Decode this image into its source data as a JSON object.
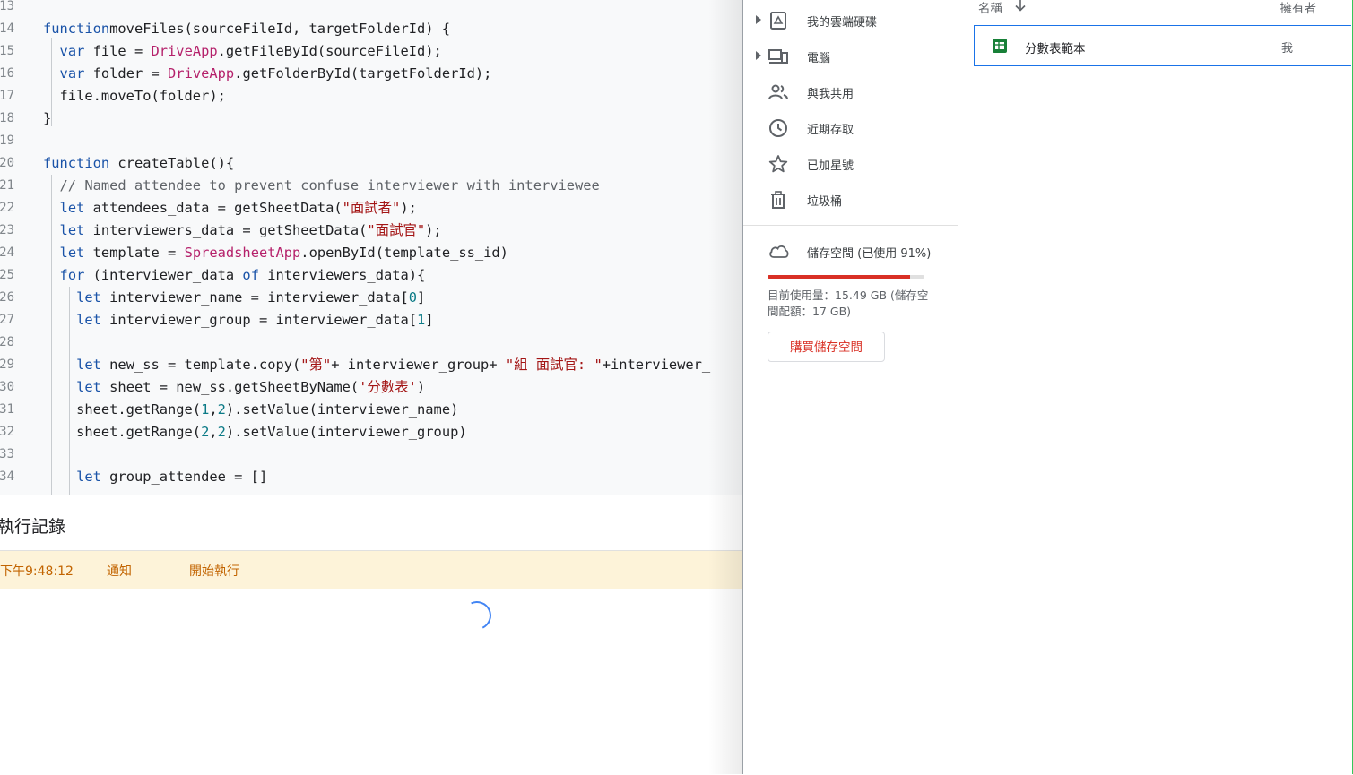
{
  "editor": {
    "lines": [
      {
        "n": "13",
        "tokens": []
      },
      {
        "n": "14",
        "tokens": [
          [
            "kw",
            "function"
          ],
          [
            "",
            "moveFiles(sourceFileId, targetFolderId) {"
          ]
        ]
      },
      {
        "n": "15",
        "tokens": [
          [
            "",
            "  "
          ],
          [
            "kw",
            "var"
          ],
          [
            "",
            " file = "
          ],
          [
            "cls",
            "DriveApp"
          ],
          [
            "",
            ".getFileById(sourceFileId);"
          ]
        ]
      },
      {
        "n": "16",
        "tokens": [
          [
            "",
            "  "
          ],
          [
            "kw",
            "var"
          ],
          [
            "",
            " folder = "
          ],
          [
            "cls",
            "DriveApp"
          ],
          [
            "",
            ".getFolderById(targetFolderId);"
          ]
        ]
      },
      {
        "n": "17",
        "tokens": [
          [
            "",
            "  file.moveTo(folder);"
          ]
        ]
      },
      {
        "n": "18",
        "tokens": [
          [
            "",
            "}"
          ]
        ]
      },
      {
        "n": "19",
        "tokens": []
      },
      {
        "n": "20",
        "tokens": [
          [
            "kw",
            "function"
          ],
          [
            "",
            " createTable(){"
          ]
        ]
      },
      {
        "n": "21",
        "tokens": [
          [
            "cmt",
            "  // Named attendee to prevent confuse interviewer with interviewee"
          ]
        ]
      },
      {
        "n": "22",
        "tokens": [
          [
            "",
            "  "
          ],
          [
            "kw",
            "let"
          ],
          [
            "",
            " attendees_data = getSheetData("
          ],
          [
            "str",
            "\"面試者\""
          ],
          [
            "",
            ");"
          ]
        ]
      },
      {
        "n": "23",
        "tokens": [
          [
            "",
            "  "
          ],
          [
            "kw",
            "let"
          ],
          [
            "",
            " interviewers_data = getSheetData("
          ],
          [
            "str",
            "\"面試官\""
          ],
          [
            "",
            ");"
          ]
        ]
      },
      {
        "n": "24",
        "tokens": [
          [
            "",
            "  "
          ],
          [
            "kw",
            "let"
          ],
          [
            "",
            " template = "
          ],
          [
            "cls",
            "SpreadsheetApp"
          ],
          [
            "",
            ".openById(template_ss_id)"
          ]
        ]
      },
      {
        "n": "25",
        "tokens": [
          [
            "",
            "  "
          ],
          [
            "kw",
            "for"
          ],
          [
            "",
            " (interviewer_data "
          ],
          [
            "kw",
            "of"
          ],
          [
            "",
            " interviewers_data){"
          ]
        ]
      },
      {
        "n": "26",
        "tokens": [
          [
            "",
            "    "
          ],
          [
            "kw",
            "let"
          ],
          [
            "",
            " interviewer_name = interviewer_data["
          ],
          [
            "num",
            "0"
          ],
          [
            "",
            "]"
          ]
        ]
      },
      {
        "n": "27",
        "tokens": [
          [
            "",
            "    "
          ],
          [
            "kw",
            "let"
          ],
          [
            "",
            " interviewer_group = interviewer_data["
          ],
          [
            "num",
            "1"
          ],
          [
            "",
            "]"
          ]
        ]
      },
      {
        "n": "28",
        "tokens": []
      },
      {
        "n": "29",
        "tokens": [
          [
            "",
            "    "
          ],
          [
            "kw",
            "let"
          ],
          [
            "",
            " new_ss = template.copy("
          ],
          [
            "str",
            "\"第\""
          ],
          [
            "",
            "+ interviewer_group+ "
          ],
          [
            "str",
            "\"組 面試官: \""
          ],
          [
            "",
            "+interviewer_"
          ]
        ]
      },
      {
        "n": "30",
        "tokens": [
          [
            "",
            "    "
          ],
          [
            "kw",
            "let"
          ],
          [
            "",
            " sheet = new_ss.getSheetByName("
          ],
          [
            "str",
            "'分數表'"
          ],
          [
            "",
            ")"
          ]
        ]
      },
      {
        "n": "31",
        "tokens": [
          [
            "",
            "    sheet.getRange("
          ],
          [
            "num",
            "1"
          ],
          [
            "",
            ","
          ],
          [
            "num",
            "2"
          ],
          [
            "",
            ").setValue(interviewer_name)"
          ]
        ]
      },
      {
        "n": "32",
        "tokens": [
          [
            "",
            "    sheet.getRange("
          ],
          [
            "num",
            "2"
          ],
          [
            "",
            ","
          ],
          [
            "num",
            "2"
          ],
          [
            "",
            ").setValue(interviewer_group)"
          ]
        ]
      },
      {
        "n": "33",
        "tokens": []
      },
      {
        "n": "34",
        "tokens": [
          [
            "",
            "    "
          ],
          [
            "kw",
            "let"
          ],
          [
            "",
            " group_attendee = []"
          ]
        ]
      }
    ]
  },
  "log": {
    "title": "執行記錄",
    "entry": {
      "time": "下午9:48:12",
      "level": "通知",
      "message": "開始執行"
    }
  },
  "drive": {
    "nav": [
      {
        "label": "我的雲端硬碟",
        "icon": "drive-icon",
        "expandable": true
      },
      {
        "label": "電腦",
        "icon": "computer-icon",
        "expandable": true
      },
      {
        "label": "與我共用",
        "icon": "people-icon",
        "expandable": false
      },
      {
        "label": "近期存取",
        "icon": "clock-icon",
        "expandable": false
      },
      {
        "label": "已加星號",
        "icon": "star-icon",
        "expandable": false
      },
      {
        "label": "垃圾桶",
        "icon": "trash-icon",
        "expandable": false
      }
    ],
    "storage": {
      "label": "儲存空間 (已使用 91%)",
      "used_fraction": 0.91,
      "detail": "目前使用量：15.49 GB (儲存空間配額：17 GB)",
      "buy_label": "購買儲存空間"
    },
    "files": {
      "col_name": "名稱",
      "col_owner": "擁有者",
      "rows": [
        {
          "name": "分數表範本",
          "owner": "我",
          "icon": "sheets-icon"
        }
      ]
    }
  },
  "colors": {
    "keyword": "#1a53a8",
    "class": "#b5216b",
    "string": "#a31515",
    "number": "#0b7a86",
    "log_bg": "#fdf3d9",
    "log_text": "#c26401",
    "danger": "#d93025"
  }
}
